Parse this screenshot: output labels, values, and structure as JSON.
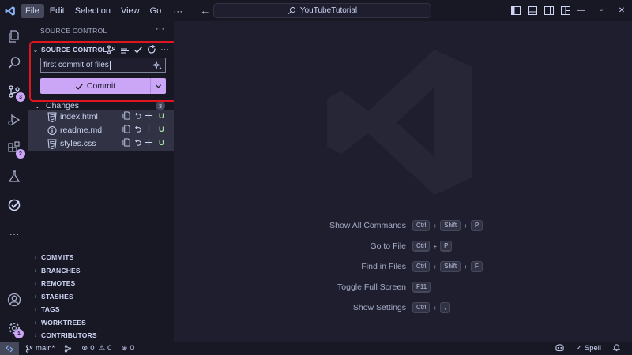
{
  "titlebar": {
    "menus": [
      "File",
      "Edit",
      "Selection",
      "View",
      "Go"
    ],
    "more": "···",
    "search_text": "YouTubeTutorial"
  },
  "activity_badges": {
    "source_control": "3",
    "extensions": "2",
    "settings": "1"
  },
  "sidebar": {
    "header": "SOURCE CONTROL",
    "header_more": "···",
    "section_title": "SOURCE CONTROL",
    "commit_message": "first commit of files",
    "commit_button": "Commit",
    "changes_label": "Changes",
    "changes_count": "3",
    "files": [
      {
        "name": "index.html",
        "icon": "html-file-icon",
        "status": "U"
      },
      {
        "name": "readme.md",
        "icon": "info-file-icon",
        "status": "U"
      },
      {
        "name": "styles.css",
        "icon": "css-file-icon",
        "status": "U"
      }
    ],
    "bottom_sections": [
      "COMMITS",
      "BRANCHES",
      "REMOTES",
      "STASHES",
      "TAGS",
      "WORKTREES",
      "CONTRIBUTORS"
    ]
  },
  "editor": {
    "shortcuts": [
      {
        "label": "Show All Commands",
        "keys": [
          "Ctrl",
          "Shift",
          "P"
        ]
      },
      {
        "label": "Go to File",
        "keys": [
          "Ctrl",
          "P"
        ]
      },
      {
        "label": "Find in Files",
        "keys": [
          "Ctrl",
          "Shift",
          "F"
        ]
      },
      {
        "label": "Toggle Full Screen",
        "keys": [
          "F11"
        ]
      },
      {
        "label": "Show Settings",
        "keys": [
          "Ctrl",
          ","
        ]
      }
    ],
    "key_separator": "+"
  },
  "statusbar": {
    "branch": "main*",
    "errors": "0",
    "warnings": "0",
    "ports": "0",
    "spell": "Spell"
  },
  "colors": {
    "accent": "#cba6f7",
    "highlight_border": "#e0141e",
    "untracked": "#a6e3a1",
    "background": "#1e1e2e"
  }
}
